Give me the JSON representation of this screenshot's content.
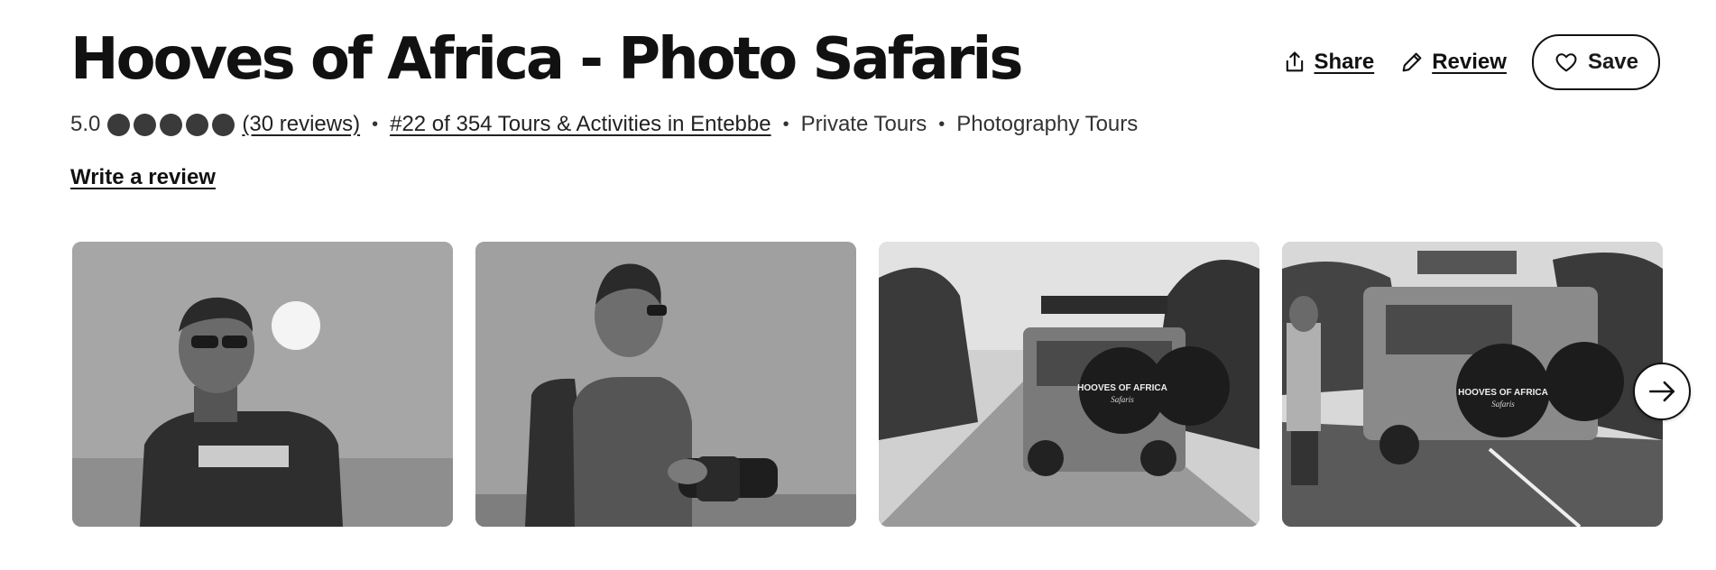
{
  "header": {
    "title": "Hooves of Africa - Photo Safaris",
    "actions": {
      "share_label": "Share",
      "review_label": "Review",
      "save_label": "Save"
    }
  },
  "meta": {
    "rating": "5.0",
    "bubbles_filled": 5,
    "reviews_link": "(30 reviews)",
    "rank_link": "#22 of 354 Tours & Activities in Entebbe",
    "categories": [
      "Private Tours",
      "Photography Tours"
    ],
    "separator": "•"
  },
  "write_review_label": "Write a review",
  "gallery": {
    "photos": [
      {
        "subject": "man-smiling-sunset"
      },
      {
        "subject": "man-with-camera"
      },
      {
        "subject": "safari-vehicle-dirt-road",
        "wheel_text": "HOOVES OF AFRICA",
        "wheel_subtext": "Safaris"
      },
      {
        "subject": "safari-vehicle-paved-road",
        "wheel_text": "HOOVES OF AFRICA",
        "wheel_subtext": "Safaris"
      }
    ],
    "next_icon": "arrow-right-icon"
  },
  "icons": {
    "share": "share-icon",
    "review": "pencil-icon",
    "save": "heart-icon"
  }
}
